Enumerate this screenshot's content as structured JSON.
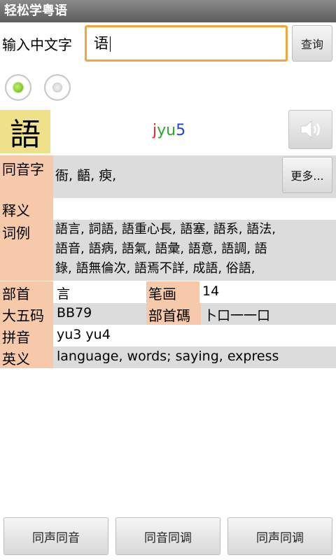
{
  "app": {
    "title": "轻松学粤语"
  },
  "search": {
    "label": "输入中文字",
    "value": "语",
    "query_button": "查询"
  },
  "radios": [
    {
      "selected": true,
      "accent": "#7bc617"
    },
    {
      "selected": false
    }
  ],
  "entry": {
    "character": "語",
    "jyutping": {
      "part1": "j",
      "part2": "yu",
      "part3": "5"
    },
    "speaker_icon": "speaker-icon"
  },
  "fields": {
    "homophones": {
      "label": "同音字",
      "value": "衙, 齬, 瘐,",
      "more_button": "更多..."
    },
    "definition": {
      "label": "释义",
      "value": ""
    },
    "examples": {
      "label": "词例",
      "lines": [
        "語言, 詞語, 語重心長, 語塞, 語系, 語法,",
        "語音, 語病, 語氣, 語彙, 語意, 語調, 語",
        "錄, 語無倫次, 語焉不詳, 成語, 俗語,"
      ]
    },
    "radical": {
      "label": "部首",
      "value": "言"
    },
    "strokes": {
      "label": "笔画",
      "value": "14"
    },
    "wubi": {
      "label": "大五码",
      "value": "BB79"
    },
    "radical_code": {
      "label": "部首碼",
      "value": "卜口一一口"
    },
    "pinyin": {
      "label": "拼音",
      "value": "yu3 yu4"
    },
    "english": {
      "label": "英义",
      "value": "language, words; saying, express"
    }
  },
  "bottom_buttons": {
    "b1": "同声同音",
    "b2": "同音同调",
    "b3": "同声同调"
  },
  "colors": {
    "label_bg": "#f6c9ab",
    "char_bg": "#efe08a",
    "input_border": "#f2a63c"
  }
}
